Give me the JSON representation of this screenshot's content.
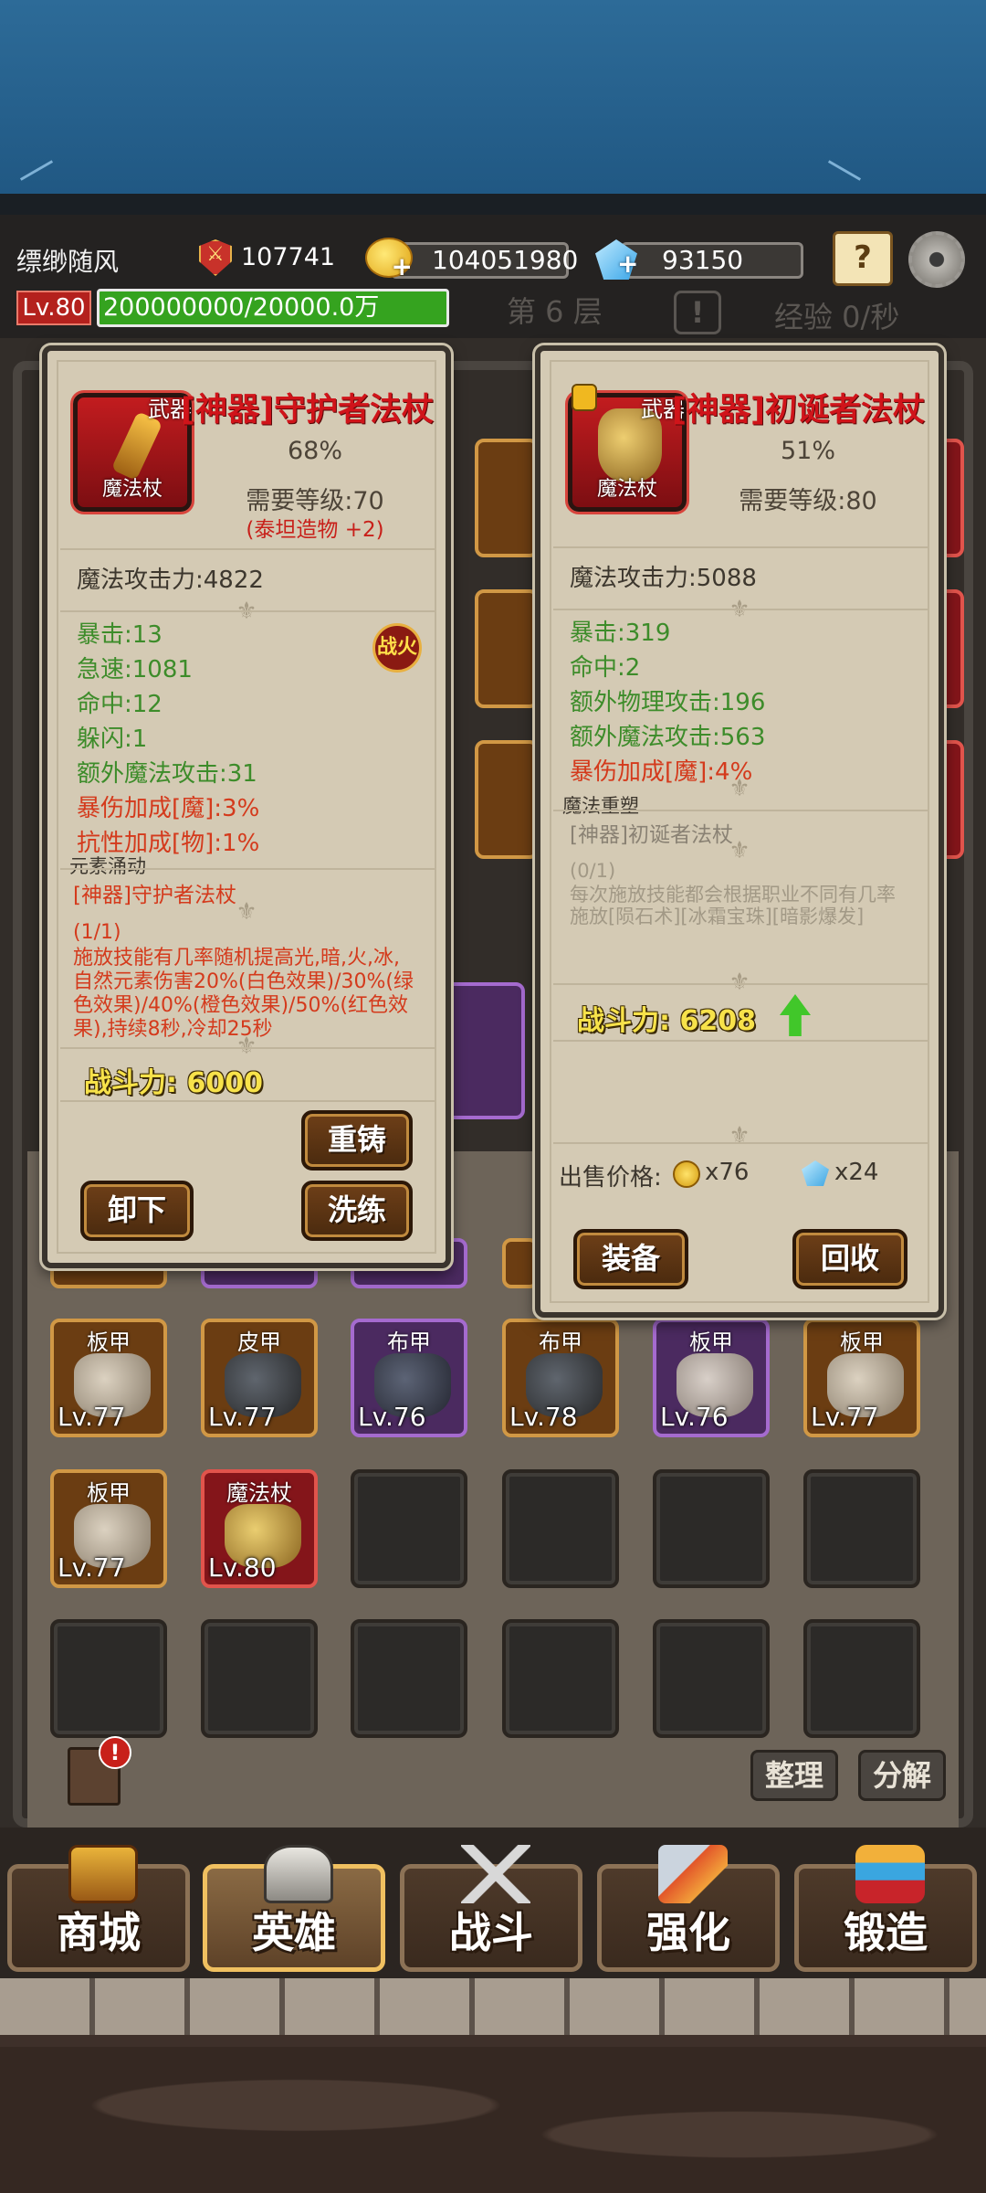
{
  "player": {
    "name": "缥缈随风",
    "power": "107741",
    "gold": "104051980",
    "gems": "93150",
    "level": "Lv.80",
    "exp": "200000000/20000.0万",
    "floor": "第 6 层",
    "exp_rate": "经验 0/秒"
  },
  "left_item": {
    "type_tag": "武器",
    "subtype": "魔法杖",
    "title": "[神器]守护者法杖",
    "percent": "68%",
    "req_level": "需要等级:70",
    "bonus": "(泰坦造物 +2)",
    "main_stat": "魔法攻击力:4822",
    "stats_green": [
      "暴击:13",
      "急速:1081",
      "命中:12",
      "躲闪:1",
      "额外魔法攻击:31"
    ],
    "stats_red": [
      "暴伤加成[魔]:3%",
      "抗性加成[物]:1%"
    ],
    "fire_badge": "战火",
    "effect_name": "元素涌动",
    "effect_item": "[神器]守护者法杖",
    "effect_count": "(1/1)",
    "effect_desc": [
      "施放技能有几率随机提高光,暗,火,冰,",
      "自然元素伤害20%(白色效果)/30%(绿",
      "色效果)/40%(橙色效果)/50%(红色效",
      "果),持续8秒,冷却25秒"
    ],
    "power": "战斗力: 6000",
    "btn_recast": "重铸",
    "btn_unequip": "卸下",
    "btn_refine": "洗练"
  },
  "right_item": {
    "type_tag": "武器",
    "subtype": "魔法杖",
    "title": "[神器]初诞者法杖",
    "percent": "51%",
    "req_level": "需要等级:80",
    "main_stat": "魔法攻击力:5088",
    "stats_green": [
      "暴击:319",
      "命中:2",
      "额外物理攻击:196",
      "额外魔法攻击:563"
    ],
    "stats_red": [
      "暴伤加成[魔]:4%"
    ],
    "effect_name": "魔法重塑",
    "effect_item": "[神器]初诞者法杖",
    "effect_count": "(0/1)",
    "effect_desc": [
      "每次施放技能都会根据职业不同有几率",
      "施放[陨石术][冰霜宝珠][暗影爆发]"
    ],
    "power": "战斗力: 6208",
    "sell_label": "出售价格:",
    "sell_gold": "x76",
    "sell_gems": "x24",
    "btn_equip": "装备",
    "btn_recycle": "回收"
  },
  "inventory": {
    "rows": [
      [
        {
          "type": "板甲",
          "level": "Lv.77",
          "rarity": "brown"
        },
        {
          "type": "皮甲",
          "level": "Lv.77",
          "rarity": "brown"
        },
        {
          "type": "布甲",
          "level": "Lv.76",
          "rarity": "purple"
        },
        {
          "type": "布甲",
          "level": "Lv.78",
          "rarity": "brown"
        },
        {
          "type": "板甲",
          "level": "Lv.76",
          "rarity": "purple"
        },
        {
          "type": "板甲",
          "level": "Lv.77",
          "rarity": "brown"
        }
      ],
      [
        {
          "type": "板甲",
          "level": "Lv.77",
          "rarity": "brown"
        },
        {
          "type": "魔法杖",
          "level": "Lv.80",
          "rarity": "red"
        }
      ]
    ],
    "btn_sort": "整理",
    "btn_decompose": "分解",
    "badge": "!"
  },
  "nav": [
    {
      "label": "商城",
      "icon": "treasure-chest-icon"
    },
    {
      "label": "英雄",
      "icon": "helmet-icon"
    },
    {
      "label": "战斗",
      "icon": "crossed-swords-icon"
    },
    {
      "label": "强化",
      "icon": "hammer-icon"
    },
    {
      "label": "锻造",
      "icon": "anvil-icon"
    }
  ],
  "colors": {
    "title_red": "#d0141a",
    "stat_green": "#3d8c2a",
    "stat_red": "#d43a1c",
    "exp_green": "#35a31f",
    "power_yellow": "#f7e24a"
  }
}
